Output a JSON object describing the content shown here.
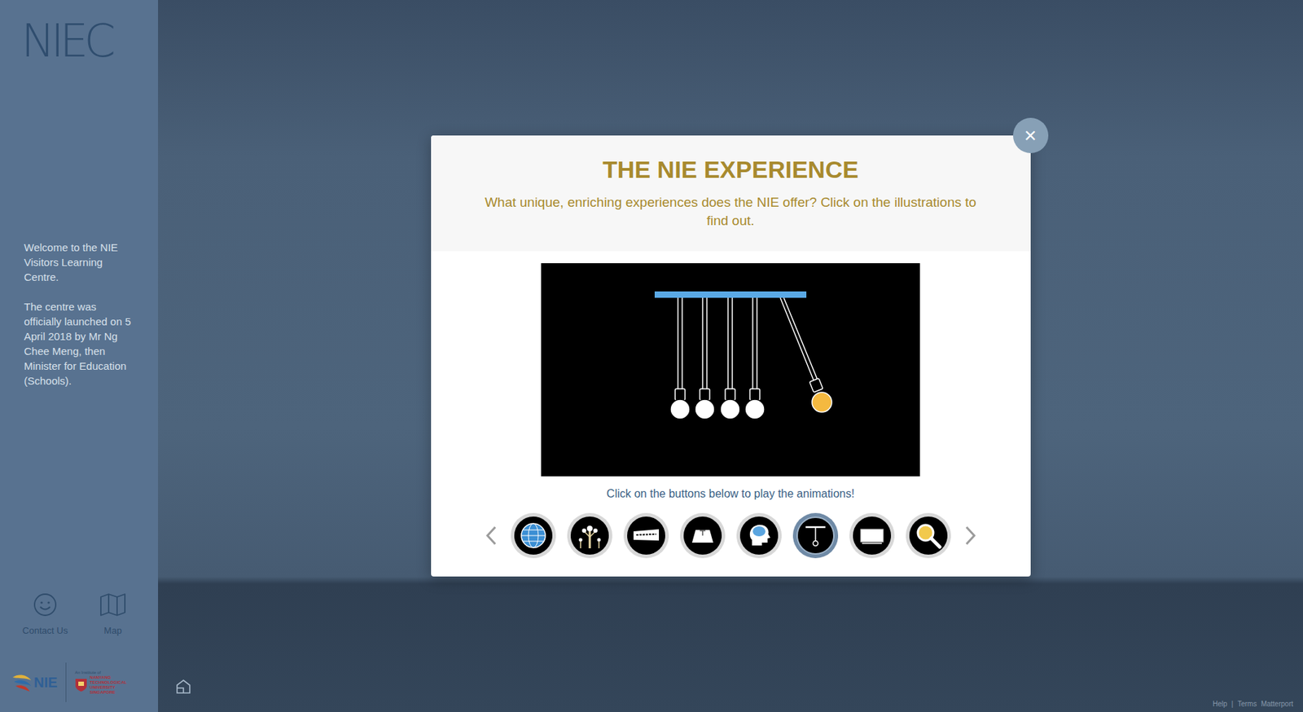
{
  "sidebar": {
    "logo": "NIEC",
    "welcome": [
      "Welcome to the NIE Visitors Learning Centre.",
      "The centre was officially launched on 5 April 2018 by Mr Ng Chee Meng, then Minister for Education (Schools)."
    ],
    "nav": [
      {
        "label": "Contact Us",
        "kind": "smiley"
      },
      {
        "label": "Map",
        "kind": "map"
      }
    ],
    "footer_logos": {
      "nie": "NIE",
      "ntu_caption": "An Institute of",
      "ntu": [
        "NANYANG",
        "TECHNOLOGICAL",
        "UNIVERSITY",
        "SINGAPORE"
      ]
    }
  },
  "modal": {
    "title": "THE NIE EXPERIENCE",
    "subtitle": "What unique, enriching experiences does the NIE offer? Click on the illustrations to find out.",
    "caption": "Click on the buttons below to play the animations!",
    "close": "×",
    "buttons": [
      {
        "kind": "globe",
        "selected": false
      },
      {
        "kind": "tree",
        "selected": false
      },
      {
        "kind": "banner",
        "selected": false
      },
      {
        "kind": "stage",
        "selected": false
      },
      {
        "kind": "head",
        "selected": false
      },
      {
        "kind": "cradle",
        "selected": true
      },
      {
        "kind": "screen",
        "selected": false
      },
      {
        "kind": "magnifier",
        "selected": false
      }
    ]
  },
  "footer": {
    "links": [
      "Help",
      "Terms",
      "Matterport"
    ],
    "separator": "|"
  }
}
